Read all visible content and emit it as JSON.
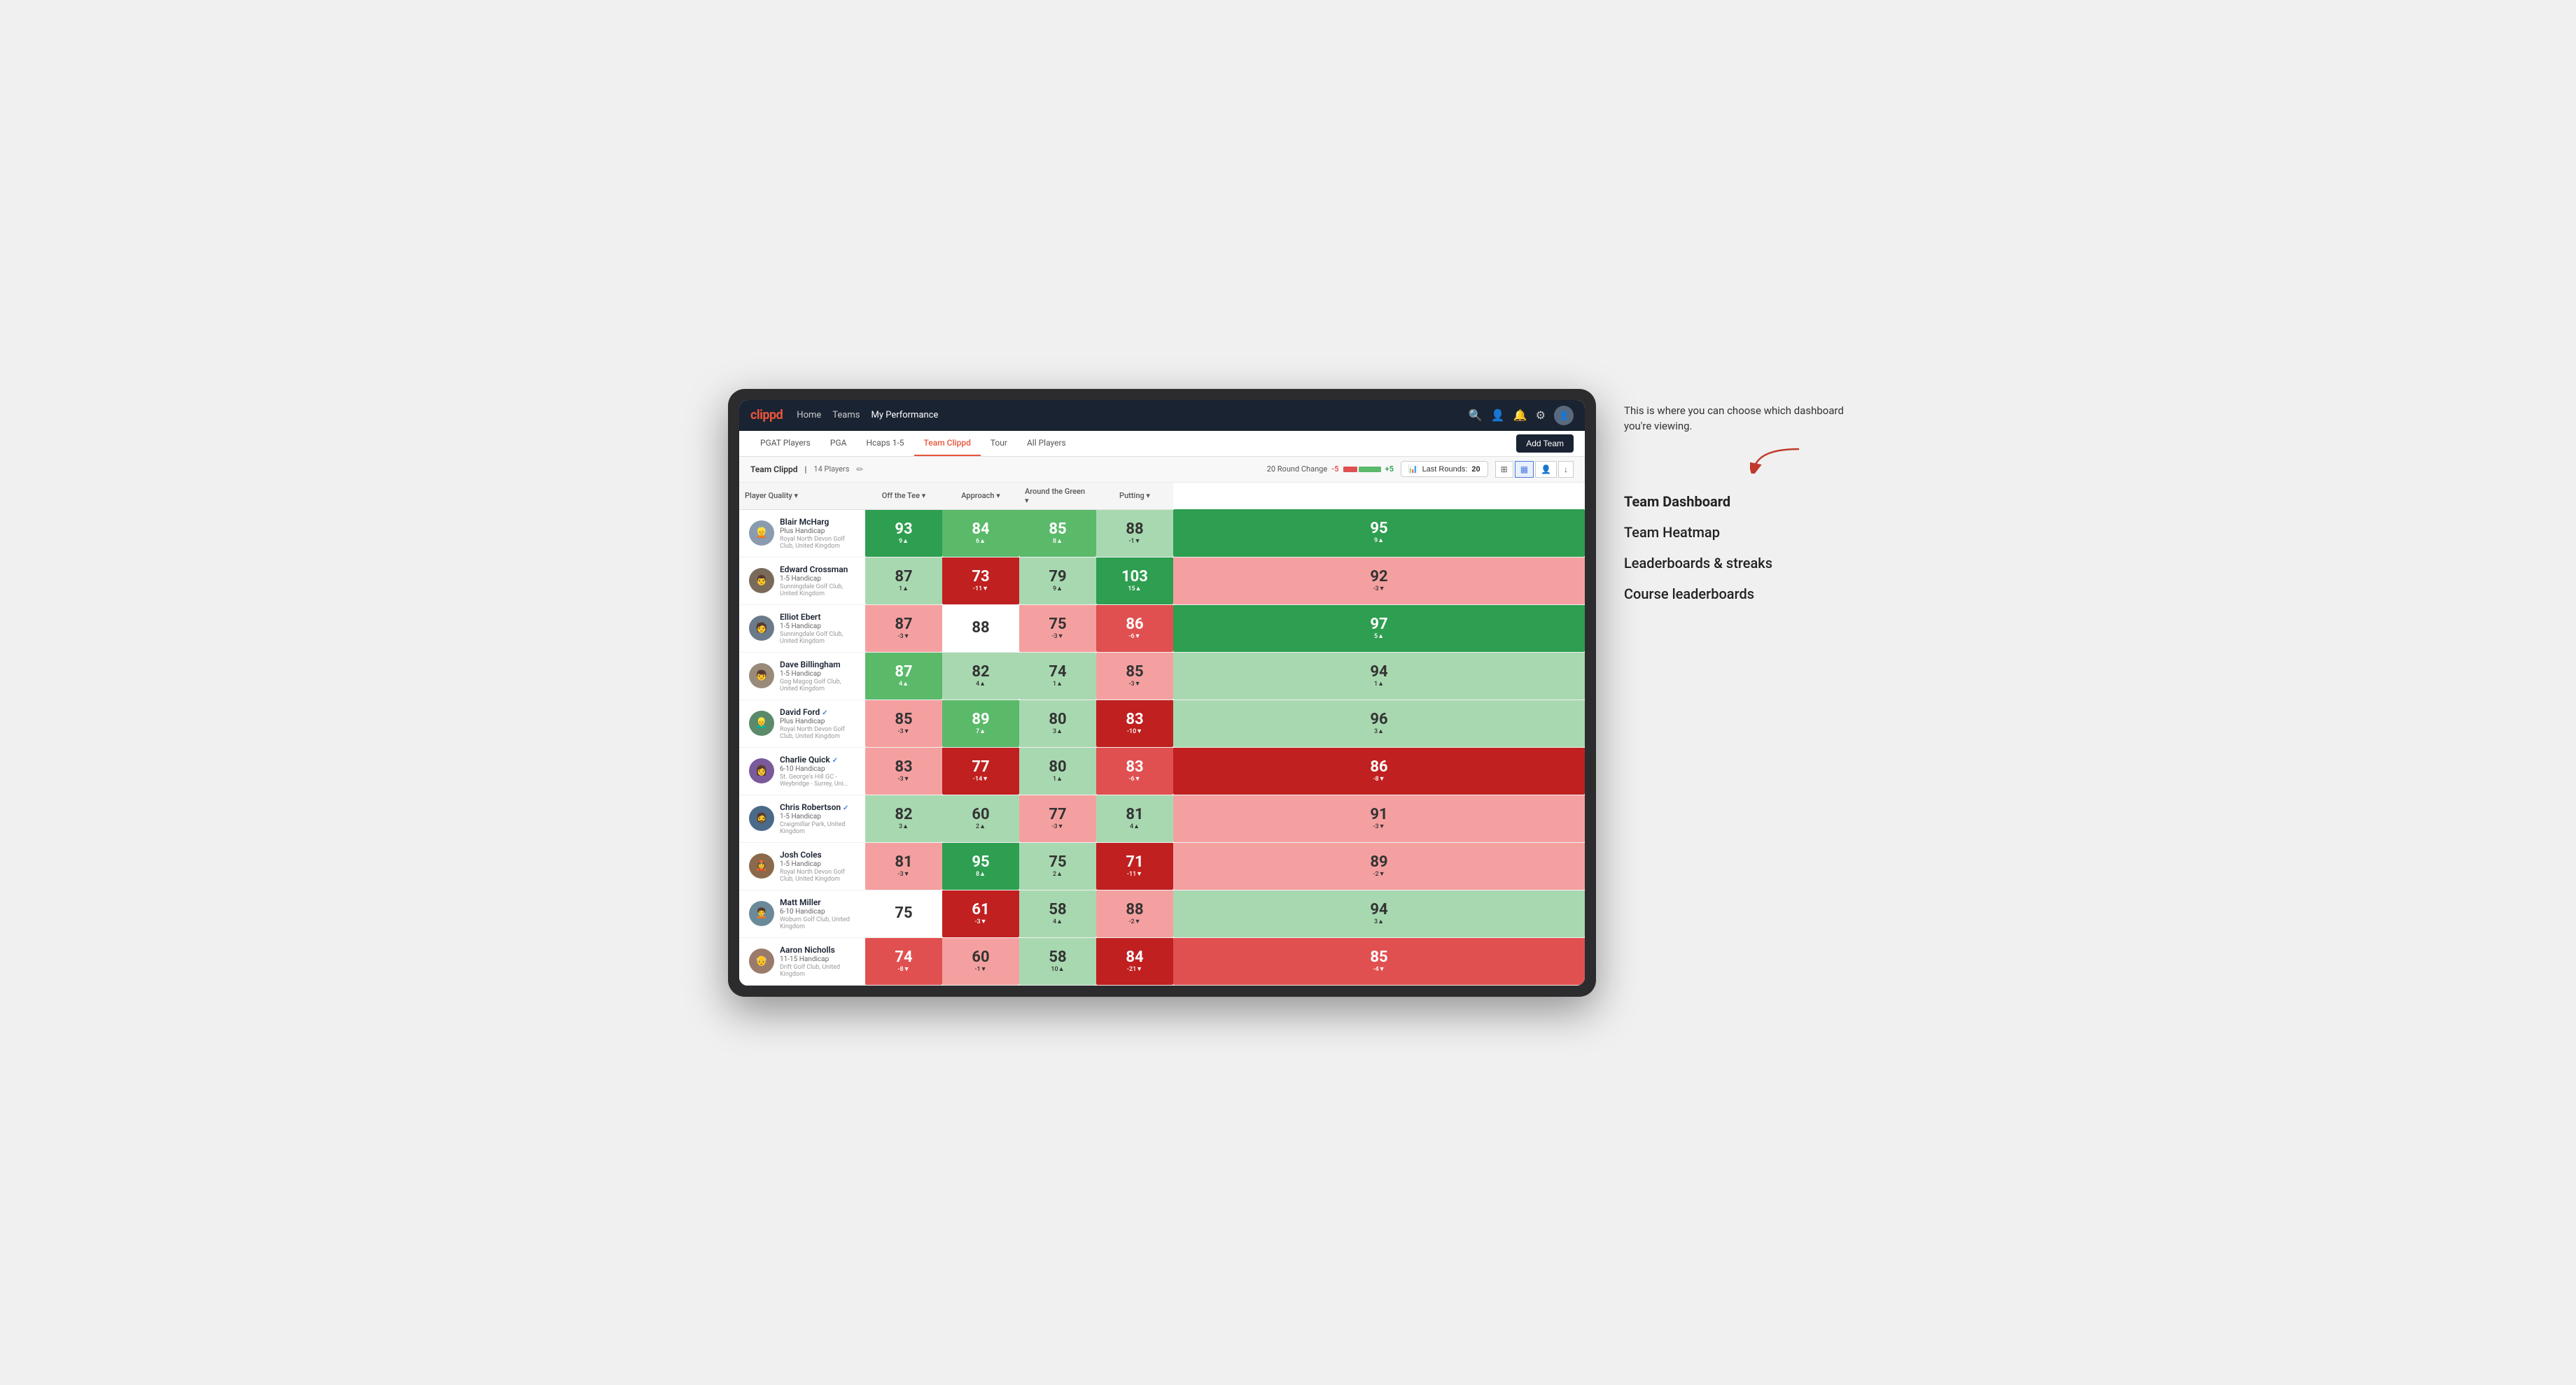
{
  "app": {
    "logo": "clippd",
    "nav": {
      "links": [
        "Home",
        "Teams",
        "My Performance"
      ],
      "active": "My Performance"
    },
    "icons": {
      "search": "🔍",
      "user": "👤",
      "bell": "🔔",
      "settings": "⚙",
      "avatar": "👤"
    }
  },
  "sub_nav": {
    "links": [
      "PGAT Players",
      "PGA",
      "Hcaps 1-5",
      "Team Clippd",
      "Tour",
      "All Players"
    ],
    "active": "Team Clippd",
    "add_team_label": "Add Team"
  },
  "team_header": {
    "team_name": "Team Clippd",
    "separator": "|",
    "player_count": "14 Players",
    "round_change_label": "20 Round Change",
    "change_neg": "-5",
    "change_pos": "+5",
    "last_rounds_label": "Last Rounds:",
    "last_rounds_value": "20"
  },
  "table": {
    "columns": {
      "player_quality": "Player Quality ▾",
      "off_tee": "Off the Tee ▾",
      "approach": "Approach ▾",
      "around_green": "Around the Green ▾",
      "putting": "Putting ▾"
    },
    "players": [
      {
        "name": "Blair McHarg",
        "handicap": "Plus Handicap",
        "club": "Royal North Devon Golf Club, United Kingdom",
        "avatar_color": "#8a9bb0",
        "scores": {
          "quality": {
            "val": "93",
            "change": "9▲",
            "heat": "heat-green-dark"
          },
          "tee": {
            "val": "84",
            "change": "6▲",
            "heat": "heat-green-med"
          },
          "approach": {
            "val": "85",
            "change": "8▲",
            "heat": "heat-green-med"
          },
          "green": {
            "val": "88",
            "change": "-1▼",
            "heat": "heat-green-light"
          },
          "putting": {
            "val": "95",
            "change": "9▲",
            "heat": "heat-green-dark"
          }
        }
      },
      {
        "name": "Edward Crossman",
        "handicap": "1-5 Handicap",
        "club": "Sunningdale Golf Club, United Kingdom",
        "avatar_color": "#7a6a5a",
        "scores": {
          "quality": {
            "val": "87",
            "change": "1▲",
            "heat": "heat-green-light"
          },
          "tee": {
            "val": "73",
            "change": "-11▼",
            "heat": "heat-red-dark"
          },
          "approach": {
            "val": "79",
            "change": "9▲",
            "heat": "heat-green-light"
          },
          "green": {
            "val": "103",
            "change": "15▲",
            "heat": "heat-green-dark"
          },
          "putting": {
            "val": "92",
            "change": "-3▼",
            "heat": "heat-red-light"
          }
        }
      },
      {
        "name": "Elliot Ebert",
        "handicap": "1-5 Handicap",
        "club": "Sunningdale Golf Club, United Kingdom",
        "avatar_color": "#6a7a8a",
        "scores": {
          "quality": {
            "val": "87",
            "change": "-3▼",
            "heat": "heat-red-light"
          },
          "tee": {
            "val": "88",
            "change": "",
            "heat": "heat-white"
          },
          "approach": {
            "val": "75",
            "change": "-3▼",
            "heat": "heat-red-light"
          },
          "green": {
            "val": "86",
            "change": "-6▼",
            "heat": "heat-red-med"
          },
          "putting": {
            "val": "97",
            "change": "5▲",
            "heat": "heat-green-dark"
          }
        }
      },
      {
        "name": "Dave Billingham",
        "handicap": "1-5 Handicap",
        "club": "Gog Magog Golf Club, United Kingdom",
        "avatar_color": "#9a8a7a",
        "scores": {
          "quality": {
            "val": "87",
            "change": "4▲",
            "heat": "heat-green-med"
          },
          "tee": {
            "val": "82",
            "change": "4▲",
            "heat": "heat-green-light"
          },
          "approach": {
            "val": "74",
            "change": "1▲",
            "heat": "heat-green-light"
          },
          "green": {
            "val": "85",
            "change": "-3▼",
            "heat": "heat-red-light"
          },
          "putting": {
            "val": "94",
            "change": "1▲",
            "heat": "heat-green-light"
          }
        }
      },
      {
        "name": "David Ford",
        "handicap": "Plus Handicap",
        "club": "Royal North Devon Golf Club, United Kingdom",
        "avatar_color": "#5a8a6a",
        "badge": "✓",
        "scores": {
          "quality": {
            "val": "85",
            "change": "-3▼",
            "heat": "heat-red-light"
          },
          "tee": {
            "val": "89",
            "change": "7▲",
            "heat": "heat-green-med"
          },
          "approach": {
            "val": "80",
            "change": "3▲",
            "heat": "heat-green-light"
          },
          "green": {
            "val": "83",
            "change": "-10▼",
            "heat": "heat-red-dark"
          },
          "putting": {
            "val": "96",
            "change": "3▲",
            "heat": "heat-green-light"
          }
        }
      },
      {
        "name": "Charlie Quick",
        "handicap": "6-10 Handicap",
        "club": "St. George's Hill GC - Weybridge - Surrey, Uni...",
        "avatar_color": "#7a5a9a",
        "badge": "✓",
        "scores": {
          "quality": {
            "val": "83",
            "change": "-3▼",
            "heat": "heat-red-light"
          },
          "tee": {
            "val": "77",
            "change": "-14▼",
            "heat": "heat-red-dark"
          },
          "approach": {
            "val": "80",
            "change": "1▲",
            "heat": "heat-green-light"
          },
          "green": {
            "val": "83",
            "change": "-6▼",
            "heat": "heat-red-med"
          },
          "putting": {
            "val": "86",
            "change": "-8▼",
            "heat": "heat-red-dark"
          }
        }
      },
      {
        "name": "Chris Robertson",
        "handicap": "1-5 Handicap",
        "club": "Craigmillar Park, United Kingdom",
        "avatar_color": "#4a6a8a",
        "badge": "✓",
        "scores": {
          "quality": {
            "val": "82",
            "change": "3▲",
            "heat": "heat-green-light"
          },
          "tee": {
            "val": "60",
            "change": "2▲",
            "heat": "heat-green-light"
          },
          "approach": {
            "val": "77",
            "change": "-3▼",
            "heat": "heat-red-light"
          },
          "green": {
            "val": "81",
            "change": "4▲",
            "heat": "heat-green-light"
          },
          "putting": {
            "val": "91",
            "change": "-3▼",
            "heat": "heat-red-light"
          }
        }
      },
      {
        "name": "Josh Coles",
        "handicap": "1-5 Handicap",
        "club": "Royal North Devon Golf Club, United Kingdom",
        "avatar_color": "#8a6a4a",
        "scores": {
          "quality": {
            "val": "81",
            "change": "-3▼",
            "heat": "heat-red-light"
          },
          "tee": {
            "val": "95",
            "change": "8▲",
            "heat": "heat-green-dark"
          },
          "approach": {
            "val": "75",
            "change": "2▲",
            "heat": "heat-green-light"
          },
          "green": {
            "val": "71",
            "change": "-11▼",
            "heat": "heat-red-dark"
          },
          "putting": {
            "val": "89",
            "change": "-2▼",
            "heat": "heat-red-light"
          }
        }
      },
      {
        "name": "Matt Miller",
        "handicap": "6-10 Handicap",
        "club": "Woburn Golf Club, United Kingdom",
        "avatar_color": "#6a8a9a",
        "scores": {
          "quality": {
            "val": "75",
            "change": "",
            "heat": "heat-white"
          },
          "tee": {
            "val": "61",
            "change": "-3▼",
            "heat": "heat-red-dark"
          },
          "approach": {
            "val": "58",
            "change": "4▲",
            "heat": "heat-green-light"
          },
          "green": {
            "val": "88",
            "change": "-2▼",
            "heat": "heat-red-light"
          },
          "putting": {
            "val": "94",
            "change": "3▲",
            "heat": "heat-green-light"
          }
        }
      },
      {
        "name": "Aaron Nicholls",
        "handicap": "11-15 Handicap",
        "club": "Drift Golf Club, United Kingdom",
        "avatar_color": "#9a7a6a",
        "scores": {
          "quality": {
            "val": "74",
            "change": "-8▼",
            "heat": "heat-red-med"
          },
          "tee": {
            "val": "60",
            "change": "-1▼",
            "heat": "heat-red-light"
          },
          "approach": {
            "val": "58",
            "change": "10▲",
            "heat": "heat-green-light"
          },
          "green": {
            "val": "84",
            "change": "-21▼",
            "heat": "heat-red-dark"
          },
          "putting": {
            "val": "85",
            "change": "-4▼",
            "heat": "heat-red-med"
          }
        }
      }
    ]
  },
  "annotation": {
    "text": "This is where you can choose which dashboard you're viewing.",
    "menu_items": [
      {
        "label": "Team Dashboard",
        "active": true
      },
      {
        "label": "Team Heatmap",
        "active": false
      },
      {
        "label": "Leaderboards & streaks",
        "active": false
      },
      {
        "label": "Course leaderboards",
        "active": false
      }
    ]
  }
}
